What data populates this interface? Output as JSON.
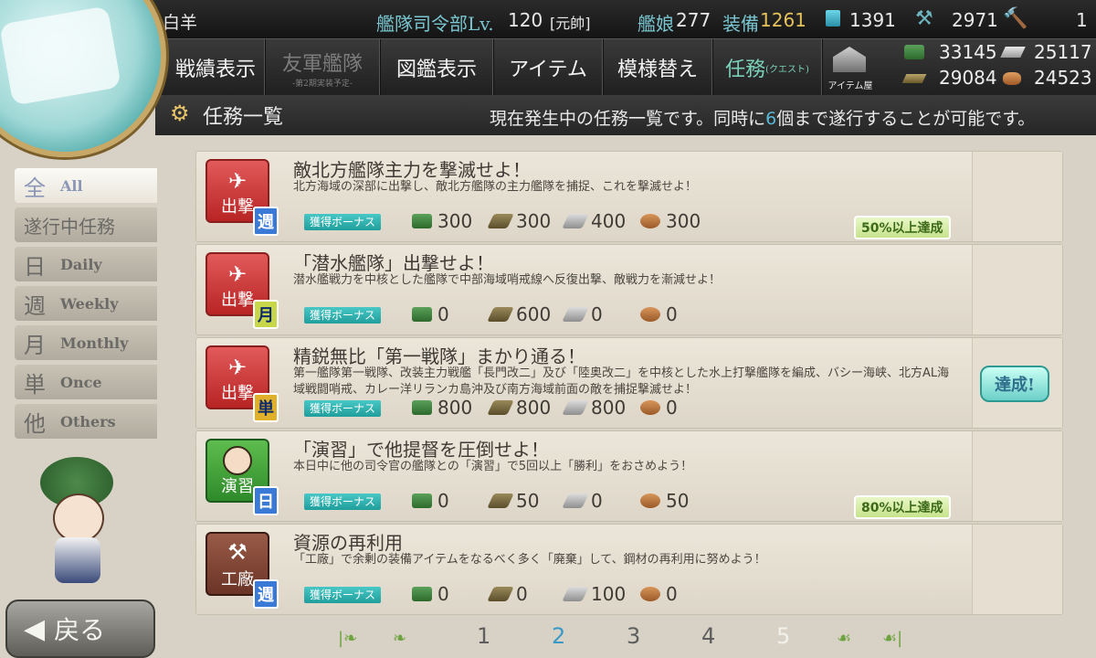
{
  "header": {
    "player_name": "白羊",
    "hq_label": "艦隊司令部Lv.",
    "hq_level": "120",
    "rank": "[元帥]",
    "ships_label": "艦娘",
    "ships_count": "277",
    "equip_label": "装備",
    "equip_count": "1261",
    "bucket_count": "1391",
    "construction_count": "2971",
    "devmat_count": "1"
  },
  "resources": {
    "fuel": "33145",
    "steel": "25117",
    "ammo": "29084",
    "bauxite": "24523"
  },
  "nav": [
    {
      "label": "戦績表示"
    },
    {
      "label": "友軍艦隊",
      "sub": "-第2期実装予定-"
    },
    {
      "label": "図鑑表示"
    },
    {
      "label": "アイテム"
    },
    {
      "label": "模様替え"
    },
    {
      "label": "任務",
      "sub": "(クエスト)"
    }
  ],
  "item_shop_label": "アイテム屋",
  "title": {
    "heading": "任務一覧",
    "message_pre": "現在発生中の任務一覧です。同時に",
    "message_num": "6",
    "message_post": "個まで遂行することが可能です。"
  },
  "sidebar": [
    {
      "big": "全",
      "small": "All"
    },
    {
      "big": "遂行中任務",
      "small": ""
    },
    {
      "big": "日",
      "small": "Daily"
    },
    {
      "big": "週",
      "small": "Weekly"
    },
    {
      "big": "月",
      "small": "Monthly"
    },
    {
      "big": "単",
      "small": "Once"
    },
    {
      "big": "他",
      "small": "Others"
    }
  ],
  "bonus_label": "獲得ボーナス",
  "quests": [
    {
      "category": "出撃",
      "type": "週",
      "title": "敵北方艦隊主力を撃滅せよ！",
      "desc": "北方海域の深部に出撃し、敵北方艦隊の主力艦隊を捕捉、これを撃滅せよ！",
      "fuel": "300",
      "ammo": "300",
      "steel": "400",
      "bauxite": "300",
      "progress": "50%以上達成"
    },
    {
      "category": "出撃",
      "type": "月",
      "title": "「潜水艦隊」出撃せよ！",
      "desc": "潜水艦戦力を中核とした艦隊で中部海域哨戒線へ反復出撃、敵戦力を漸減せよ！",
      "fuel": "0",
      "ammo": "600",
      "steel": "0",
      "bauxite": "0",
      "progress": ""
    },
    {
      "category": "出撃",
      "type": "単",
      "title": "精鋭無比「第一戦隊」まかり通る！",
      "desc": "第一艦隊第一戦隊、改装主力戦艦「長門改二」及び「陸奥改二」を中核とした水上打撃艦隊を編成、バシー海峡、北方AL海域戦闘哨戒、カレー洋リランカ島沖及び南方海域前面の敵を捕捉撃滅せよ！",
      "fuel": "800",
      "ammo": "800",
      "steel": "800",
      "bauxite": "0",
      "progress": "達成!"
    },
    {
      "category": "演習",
      "type": "日",
      "title": "「演習」で他提督を圧倒せよ！",
      "desc": "本日中に他の司令官の艦隊との「演習」で5回以上「勝利」をおさめよう！",
      "fuel": "0",
      "ammo": "50",
      "steel": "0",
      "bauxite": "50",
      "progress": "80%以上達成"
    },
    {
      "category": "工廠",
      "type": "週",
      "title": "資源の再利用",
      "desc": "「工廠」で余剰の装備アイテムをなるべく多く「廃棄」して、鋼材の再利用に努めよう！",
      "fuel": "0",
      "ammo": "0",
      "steel": "100",
      "bauxite": "0",
      "progress": ""
    }
  ],
  "pagination": {
    "pages": [
      "1",
      "2",
      "3",
      "4",
      "5"
    ],
    "current": "2"
  },
  "back_label": "戻る",
  "colors": {
    "accent": "#3a9ac7",
    "bonus": "#2fb3b1",
    "sortie": "#c83030",
    "exercise": "#3e9a34"
  }
}
